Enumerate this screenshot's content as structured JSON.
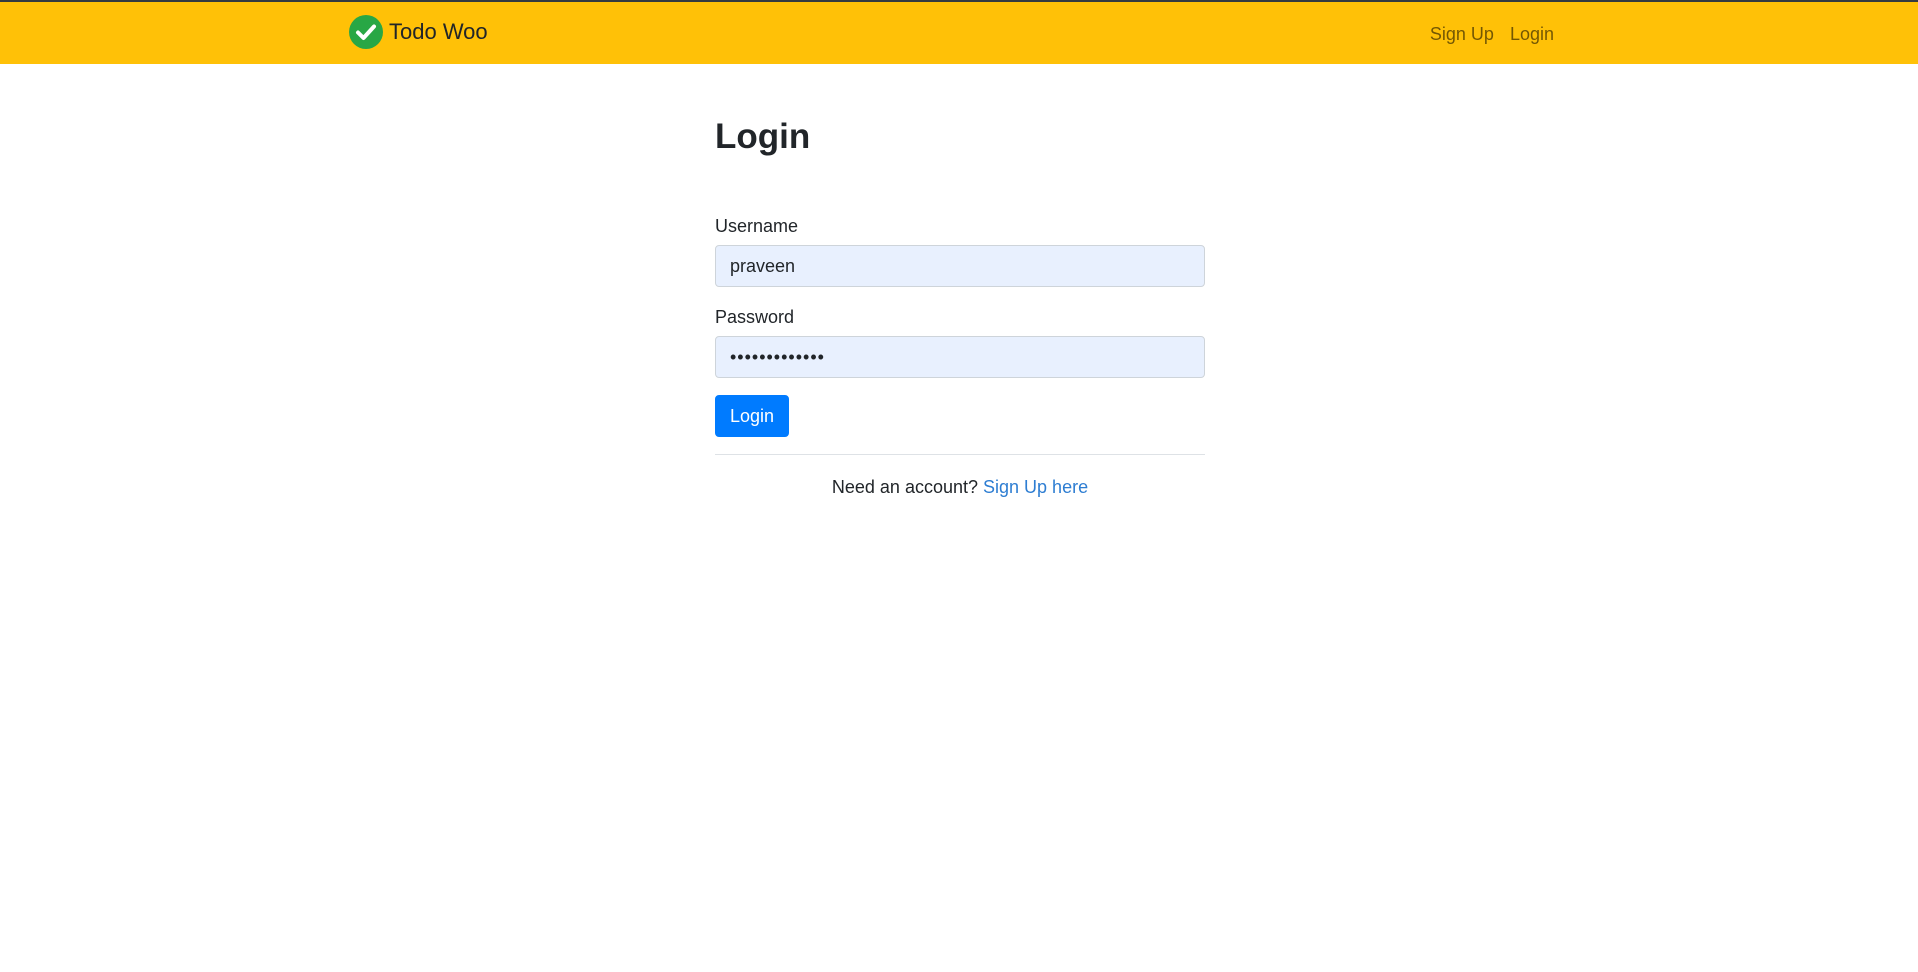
{
  "navbar": {
    "brand_name": "Todo Woo",
    "brand_icon": "check-circle-icon",
    "links": [
      {
        "label": "Sign Up"
      },
      {
        "label": "Login"
      }
    ],
    "background_color": "#ffc107"
  },
  "page": {
    "title": "Login"
  },
  "form": {
    "username_label": "Username",
    "username_value": "praveen",
    "password_label": "Password",
    "password_value": "•••••••••••••",
    "submit_label": "Login"
  },
  "footer": {
    "prompt_text": "Need an account?",
    "signup_link_label": "Sign Up here"
  },
  "colors": {
    "accent": "#007bff",
    "link": "#2d7dd2",
    "brand_icon": "#28a745"
  }
}
